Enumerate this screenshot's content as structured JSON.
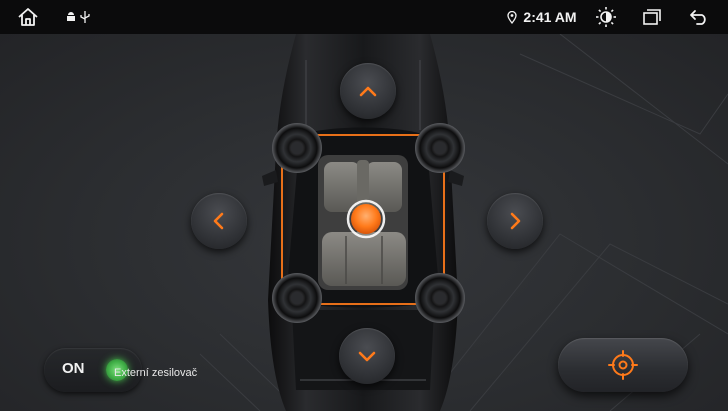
{
  "status_bar": {
    "home_icon": "home-icon",
    "notification_icons": [
      "android-icon",
      "usb-icon"
    ],
    "location_icon": "location-pin-icon",
    "time": "2:41 AM",
    "brightness_icon": "brightness-icon",
    "recents_icon": "recent-apps-icon",
    "back_icon": "back-arrow-icon"
  },
  "balance_control": {
    "up_icon": "chevron-up-icon",
    "down_icon": "chevron-down-icon",
    "left_icon": "chevron-left-icon",
    "right_icon": "chevron-right-icon",
    "focus_point_icon": "sound-focus-handle",
    "speaker_icons": [
      "speaker-front-left",
      "speaker-front-right",
      "speaker-rear-left",
      "speaker-rear-right"
    ]
  },
  "amp_toggle": {
    "state_label": "ON",
    "label": "Externí zesilovač"
  },
  "center_button": {
    "icon": "crosshair-icon"
  },
  "colors": {
    "accent": "#ff7a1a",
    "background": "#2a2c2f",
    "status_bar": "#0b0b0c",
    "toggle_on": "#4cc552"
  }
}
